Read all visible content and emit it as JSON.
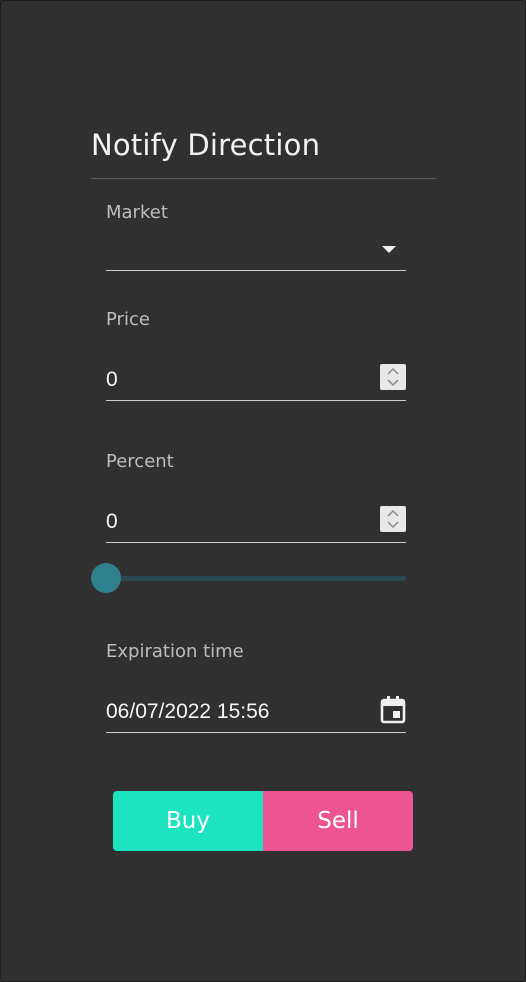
{
  "dialog": {
    "title": "Notify Direction"
  },
  "market": {
    "label": "Market",
    "value": "",
    "dropdown_icon": "caret-down-icon"
  },
  "price": {
    "label": "Price",
    "value": "0",
    "spinner_icon": "spinner-icon"
  },
  "percent": {
    "label": "Percent",
    "value": "0",
    "spinner_icon": "spinner-icon",
    "slider_value": 0
  },
  "expiration": {
    "label": "Expiration time",
    "value": "06/07/2022 15:56",
    "calendar_icon": "calendar-icon"
  },
  "actions": {
    "buy_label": "Buy",
    "sell_label": "Sell"
  },
  "colors": {
    "background": "#303030",
    "buy": "#1ee3c0",
    "sell": "#ec5590",
    "slider_thumb": "#2f7f8c",
    "slider_track": "#2c4a50"
  }
}
